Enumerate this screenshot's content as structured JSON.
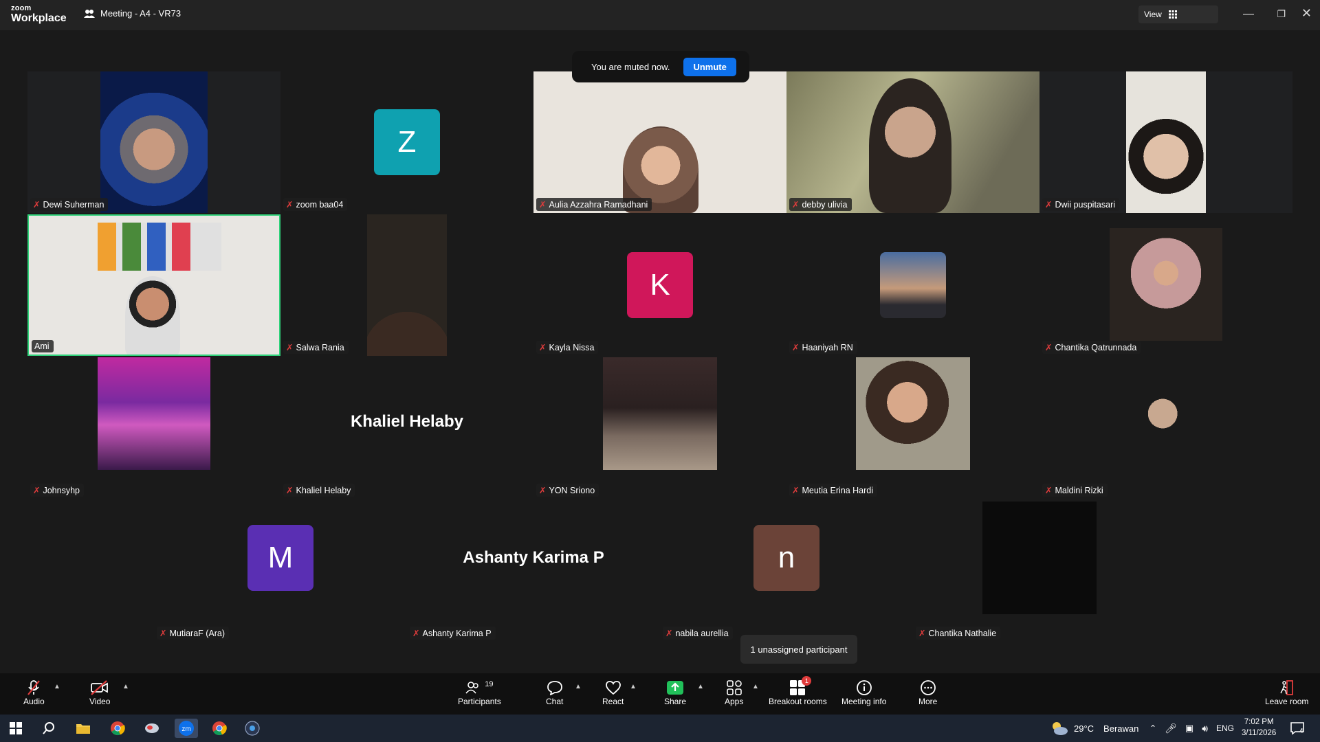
{
  "app": {
    "logo_line1": "zoom",
    "logo_line2": "Workplace",
    "meeting_title": "Meeting - A4 - VR73",
    "view_label": "View"
  },
  "toast": {
    "message": "You are muted now.",
    "unmute_label": "Unmute"
  },
  "tiles": [
    {
      "name": "Dewi Suherman"
    },
    {
      "name": "zoom baa04",
      "initial": "Z"
    },
    {
      "name": "Aulia Azzahra Ramadhani"
    },
    {
      "name": "debby ulivia"
    },
    {
      "name": "Dwii puspitasari"
    },
    {
      "name": "Ami"
    },
    {
      "name": "Salwa Rania"
    },
    {
      "name": "Kayla Nissa",
      "initial": "K"
    },
    {
      "name": "Haaniyah RN"
    },
    {
      "name": "Chantika Qatrunnada"
    },
    {
      "name": "Johnsyhp"
    },
    {
      "name": "Khaliel Helaby",
      "display": "Khaliel Helaby"
    },
    {
      "name": "YON Sriono"
    },
    {
      "name": "Meutia Erina Hardi"
    },
    {
      "name": "Maldini Rizki"
    },
    {
      "name": "MutiaraF (Ara)",
      "initial": "M"
    },
    {
      "name": "Ashanty Karima P",
      "display": "Ashanty Karima P"
    },
    {
      "name": "nabila aurellia",
      "initial": "n"
    },
    {
      "name": "Chantika Nathalie"
    }
  ],
  "tooltip": "1 unassigned participant",
  "toolbar": {
    "audio": "Audio",
    "video": "Video",
    "participants": "Participants",
    "participants_count": "19",
    "chat": "Chat",
    "react": "React",
    "share": "Share",
    "apps": "Apps",
    "breakout": "Breakout rooms",
    "breakout_badge": "1",
    "meeting_info": "Meeting info",
    "more": "More",
    "leave": "Leave room"
  },
  "taskbar": {
    "weather_temp": "29°C",
    "weather_desc": "Berawan",
    "lang": "ENG",
    "time": "7:02 PM",
    "date": "3/11/2026",
    "notif_count": "4"
  },
  "colors": {
    "zoom_blue": "#0e71eb",
    "teal": "#0fa1b0",
    "magenta": "#d0175a",
    "purple": "#5a2fb3",
    "brown": "#6b4338",
    "active_border": "#2fd27a"
  }
}
